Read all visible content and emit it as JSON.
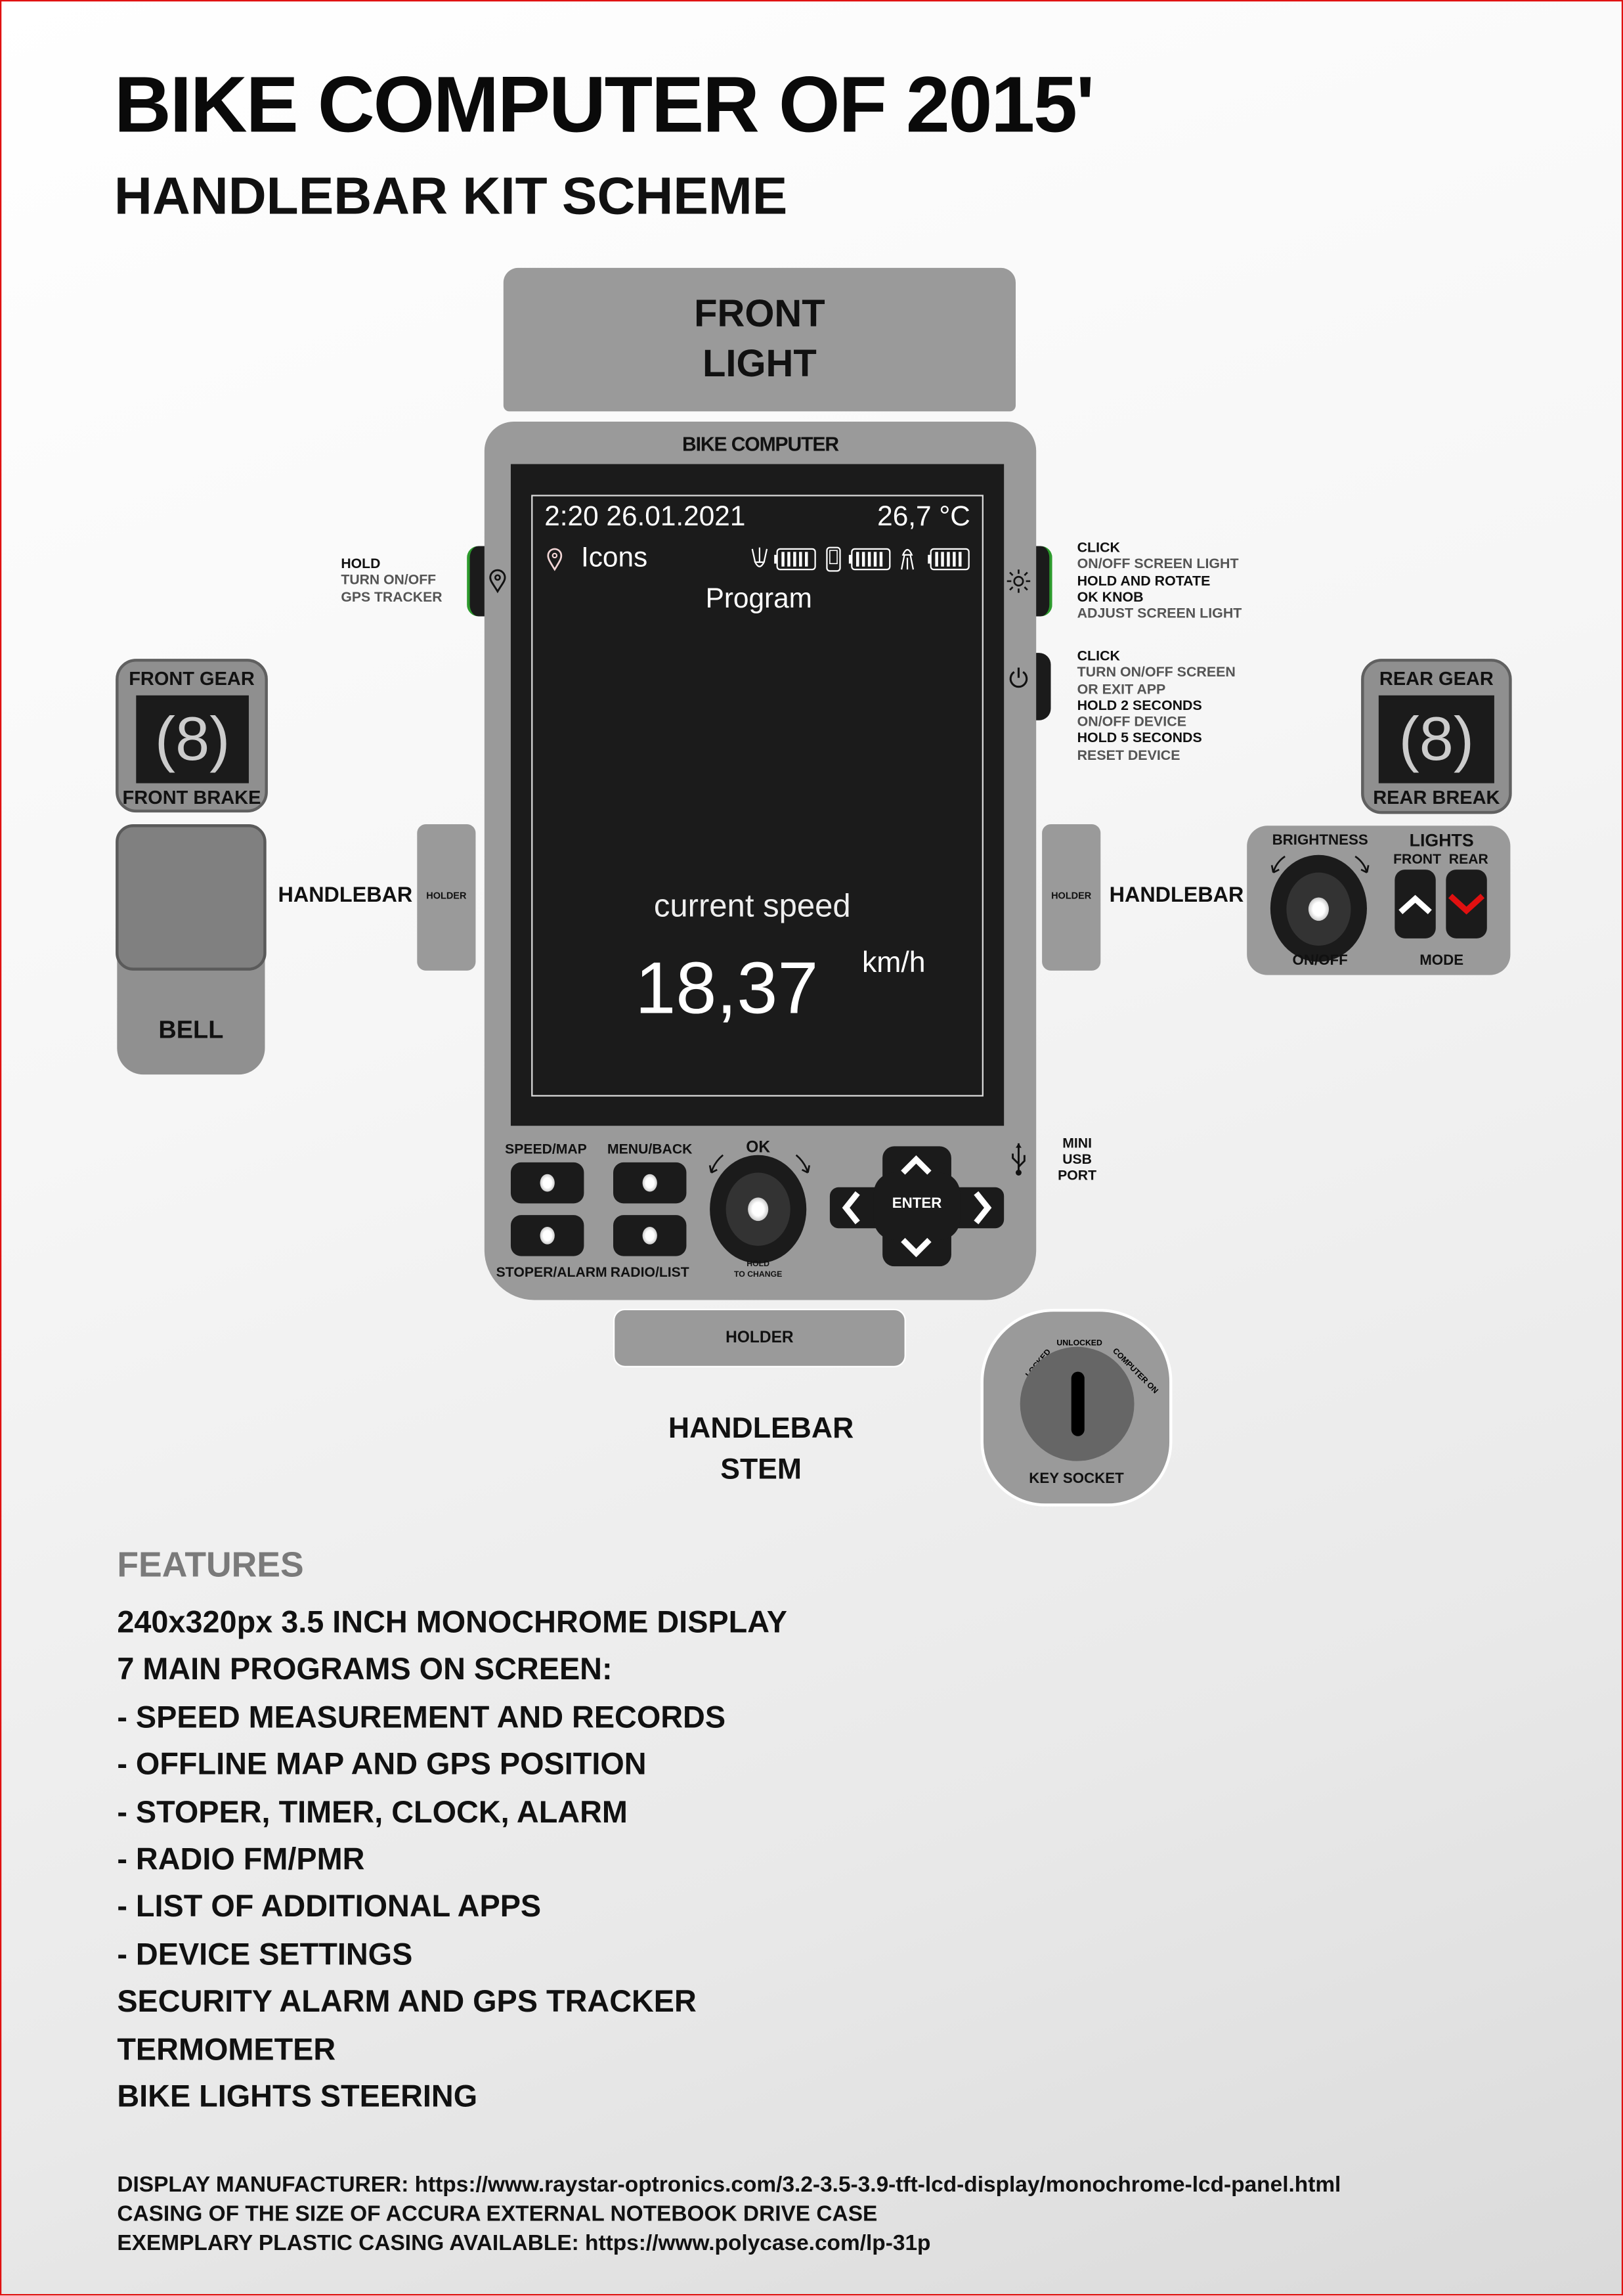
{
  "title": "BIKE COMPUTER OF 2015'",
  "subtitle": "HANDLEBAR KIT SCHEME",
  "front_light": [
    "FRONT",
    "LIGHT"
  ],
  "device": {
    "label": "BIKE COMPUTER",
    "screen": {
      "datetime": "2:20 26.01.2021",
      "temperature": "26,7 °C",
      "icons_label": "Icons",
      "program": "Program",
      "speed_label": "current speed",
      "speed": "18,37",
      "unit": "km/h",
      "battery_icons": [
        "front-light-icon",
        "phone-icon",
        "rear-light-icon"
      ]
    },
    "buttons": {
      "speed_map": "SPEED/MAP",
      "menu_back": "MENU/BACK",
      "stoper_alarm": "STOPER/ALARM",
      "radio_list": "RADIO/LIST",
      "ok": "OK",
      "ok_hint": [
        "HOLD",
        "TO CHANGE"
      ],
      "enter": "ENTER"
    },
    "usb": [
      "MINI",
      "USB",
      "PORT"
    ]
  },
  "left_button_help": [
    "HOLD",
    "TURN ON/OFF",
    "GPS TRACKER"
  ],
  "light_button_help": [
    "CLICK",
    "ON/OFF SCREEN LIGHT",
    "HOLD AND ROTATE",
    "OK KNOB",
    "ADJUST SCREEN LIGHT"
  ],
  "power_button_help": [
    "CLICK",
    "TURN ON/OFF SCREEN",
    "OR EXIT APP",
    "HOLD 2 SECONDS",
    "ON/OFF DEVICE",
    "HOLD 5 SECONDS",
    "RESET DEVICE"
  ],
  "front_gear": {
    "top": "FRONT GEAR",
    "digit": "8",
    "bottom": "FRONT BRAKE"
  },
  "rear_gear": {
    "top": "REAR GEAR",
    "digit": "8",
    "bottom": "REAR BREAK"
  },
  "bell": "BELL",
  "handlebar": "HANDLEBAR",
  "holder": "HOLDER",
  "lights_panel": {
    "brightness": "BRIGHTNESS",
    "lights": "LIGHTS",
    "front": "FRONT",
    "rear": "REAR",
    "on_off": "ON/OFF",
    "mode": "MODE",
    "front_arrow_color": "#ffffff",
    "rear_arrow_color": "#e01010"
  },
  "stem": [
    "HANDLEBAR",
    "STEM"
  ],
  "key_socket": {
    "label": "KEY SOCKET",
    "locked": "LOCKED",
    "unlocked": "UNLOCKED",
    "computer_on": "COMPUTER ON"
  },
  "features": {
    "heading": "FEATURES",
    "items": [
      "240x320px 3.5 INCH MONOCHROME DISPLAY",
      "7 MAIN PROGRAMS ON SCREEN:",
      "- SPEED MEASUREMENT AND RECORDS",
      "- OFFLINE MAP AND GPS POSITION",
      "- STOPER, TIMER, CLOCK, ALARM",
      "- RADIO FM/PMR",
      "- LIST OF ADDITIONAL APPS",
      "- DEVICE SETTINGS",
      "SECURITY ALARM AND GPS TRACKER",
      "TERMOMETER",
      "BIKE LIGHTS STEERING"
    ]
  },
  "footer": [
    "DISPLAY MANUFACTURER: https://www.raystar-optronics.com/3.2-3.5-3.9-tft-lcd-display/monochrome-lcd-panel.html",
    "CASING OF THE SIZE OF ACCURA EXTERNAL NOTEBOOK DRIVE CASE",
    "EXEMPLARY PLASTIC CASING AVAILABLE: https://www.polycase.com/lp-31p"
  ]
}
